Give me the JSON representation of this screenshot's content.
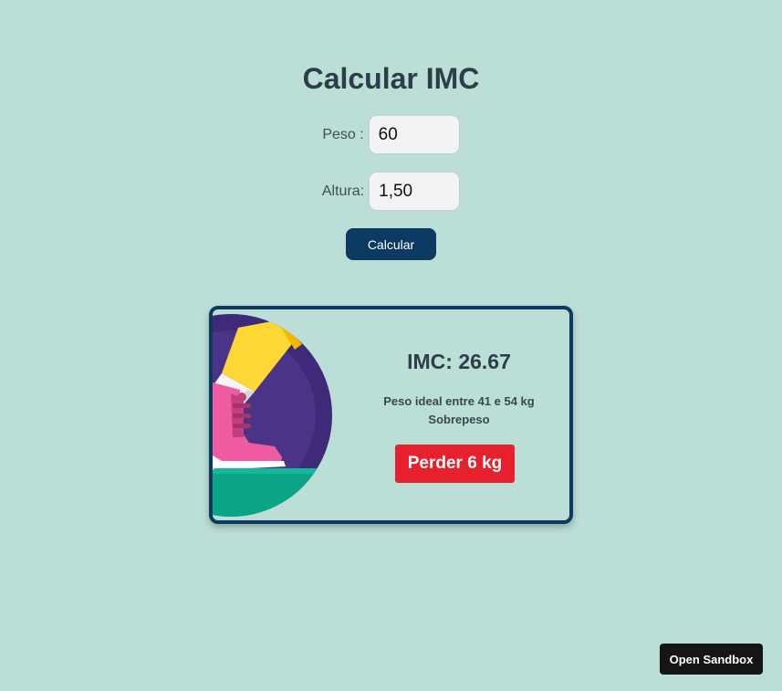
{
  "page": {
    "title": "Calcular IMC"
  },
  "form": {
    "peso_label": "Peso :",
    "peso_value": "60",
    "altura_label": "Altura:",
    "altura_value": "1,50",
    "submit_label": "Calcular"
  },
  "result": {
    "imc_text": "IMC: 26.67",
    "ideal_text": "Peso ideal entre 41 e 54 kg",
    "status_text": "Sobrepeso",
    "action_text": "Perder 6 kg",
    "illustration_icon": "walking-shoe-illustration"
  },
  "sandbox": {
    "label": "Open Sandbox"
  },
  "colors": {
    "background": "#bbdfd6",
    "primary": "#0d3a62",
    "alert": "#e8202d"
  }
}
